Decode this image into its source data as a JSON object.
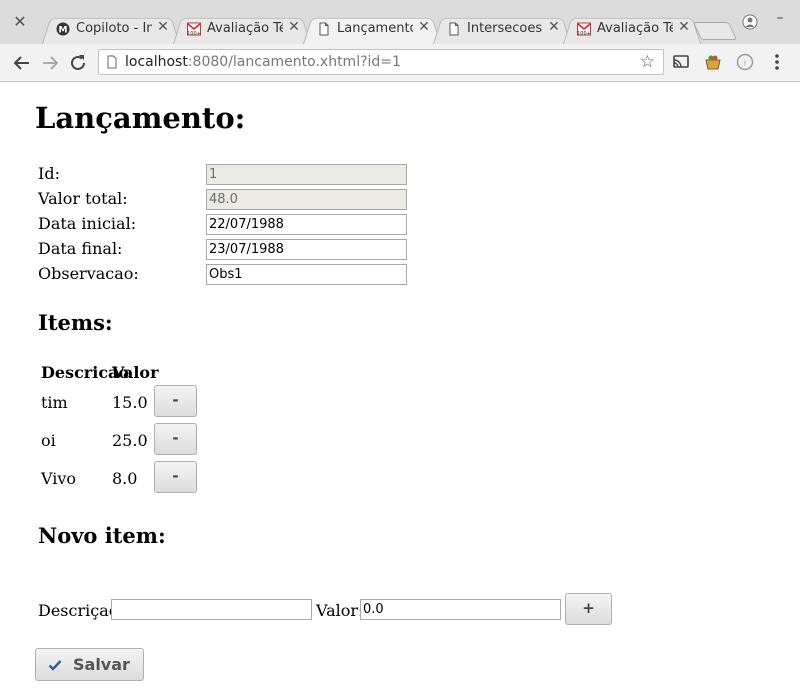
{
  "browser": {
    "tabs": [
      {
        "title": "Copiloto - Ini",
        "icon": "copiloto-logo-icon"
      },
      {
        "title": "Avaliação Té",
        "icon": "gmail-icon"
      },
      {
        "title": "Lançamento",
        "icon": "document-icon"
      },
      {
        "title": "Intersecoes",
        "icon": "document-icon"
      },
      {
        "title": "Avaliação Té",
        "icon": "gmail-icon"
      }
    ],
    "active_tab": 2,
    "url_host": "localhost",
    "url_path": ":8080/lancamento.xhtml?id=1"
  },
  "page": {
    "title": "Lançamento:",
    "fields": {
      "id": {
        "label": "Id:",
        "value": "1"
      },
      "valor_total": {
        "label": "Valor total:",
        "value": "48.0"
      },
      "data_inicial": {
        "label": "Data inicial:",
        "value": "22/07/1988"
      },
      "data_final": {
        "label": "Data final:",
        "value": "23/07/1988"
      },
      "observacao": {
        "label": "Observacao:",
        "value": "Obs1"
      }
    },
    "items_heading": "Items:",
    "items_table": {
      "headers": [
        "Descricao",
        "Valor"
      ],
      "rows": [
        {
          "descricao": "tim",
          "valor": "15.0",
          "remove_label": "-"
        },
        {
          "descricao": "oi",
          "valor": "25.0",
          "remove_label": "-"
        },
        {
          "descricao": "Vivo",
          "valor": "8.0",
          "remove_label": "-"
        }
      ]
    },
    "novo_item": {
      "heading": "Novo item:",
      "descricao_label": "Descriçao:",
      "descricao_value": "",
      "valor_label": "Valor:",
      "valor_value": "0.0",
      "add_label": "+"
    },
    "save_label": "Salvar"
  }
}
